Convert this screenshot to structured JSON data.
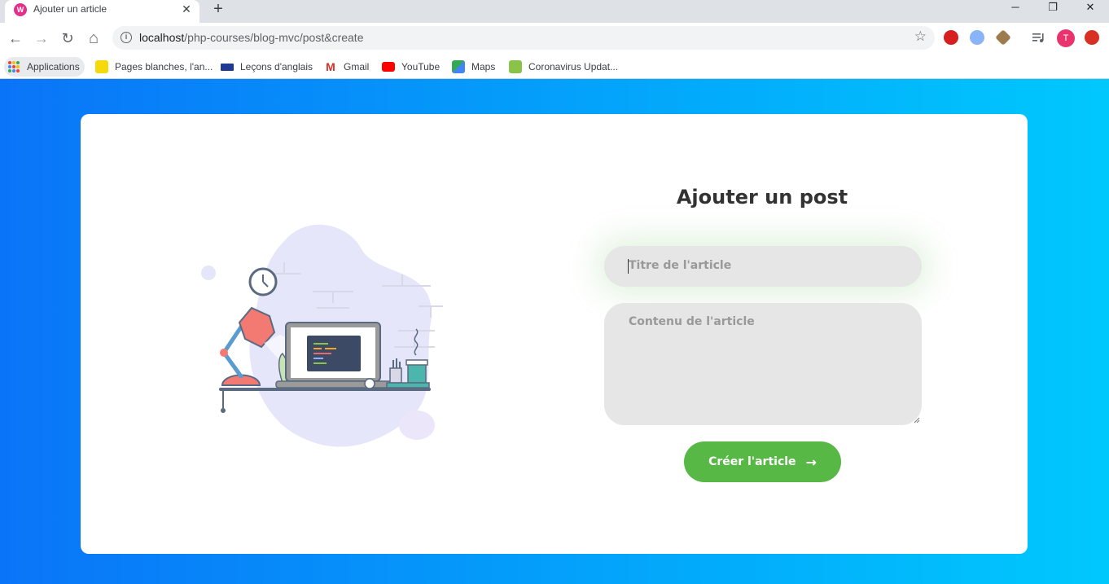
{
  "browser": {
    "tab": {
      "title": "Ajouter un article",
      "favicon_icon": "wamp-icon",
      "close_icon": "close-icon"
    },
    "new_tab_icon": "plus-icon",
    "window_controls": {
      "minimize": "─",
      "restore": "❐",
      "close": "✕"
    },
    "nav": {
      "back": "←",
      "forward": "→",
      "reload": "↻",
      "home": "⌂"
    },
    "address": {
      "host": "localhost",
      "path": "/php-courses/blog-mvc/post&create"
    },
    "profile_initial": "T",
    "bookmarks": [
      {
        "label": "Applications",
        "icon": "apps-grid-icon"
      },
      {
        "label": "Pages blanches, l'an...",
        "icon": "pages-blanches-icon",
        "color": "#f5d90a"
      },
      {
        "label": "Leçons d'anglais",
        "icon": "flag-uk-icon",
        "color": "#1f3a93"
      },
      {
        "label": "Gmail",
        "icon": "gmail-icon",
        "color": "#d93025"
      },
      {
        "label": "YouTube",
        "icon": "youtube-icon",
        "color": "#ff0000"
      },
      {
        "label": "Maps",
        "icon": "maps-icon",
        "color": "#34a853"
      },
      {
        "label": "Coronavirus Updat...",
        "icon": "worldometer-icon",
        "color": "#8bc34a"
      }
    ]
  },
  "form": {
    "title": "Ajouter un post",
    "title_placeholder": "Titre de l'article",
    "content_placeholder": "Contenu de l'article",
    "submit_label": "Créer l'article",
    "submit_icon": "→"
  },
  "colors": {
    "gradient_start": "#0a74f8",
    "gradient_end": "#00c8fd",
    "submit": "#57b846",
    "input_bg": "#e6e6e6"
  }
}
